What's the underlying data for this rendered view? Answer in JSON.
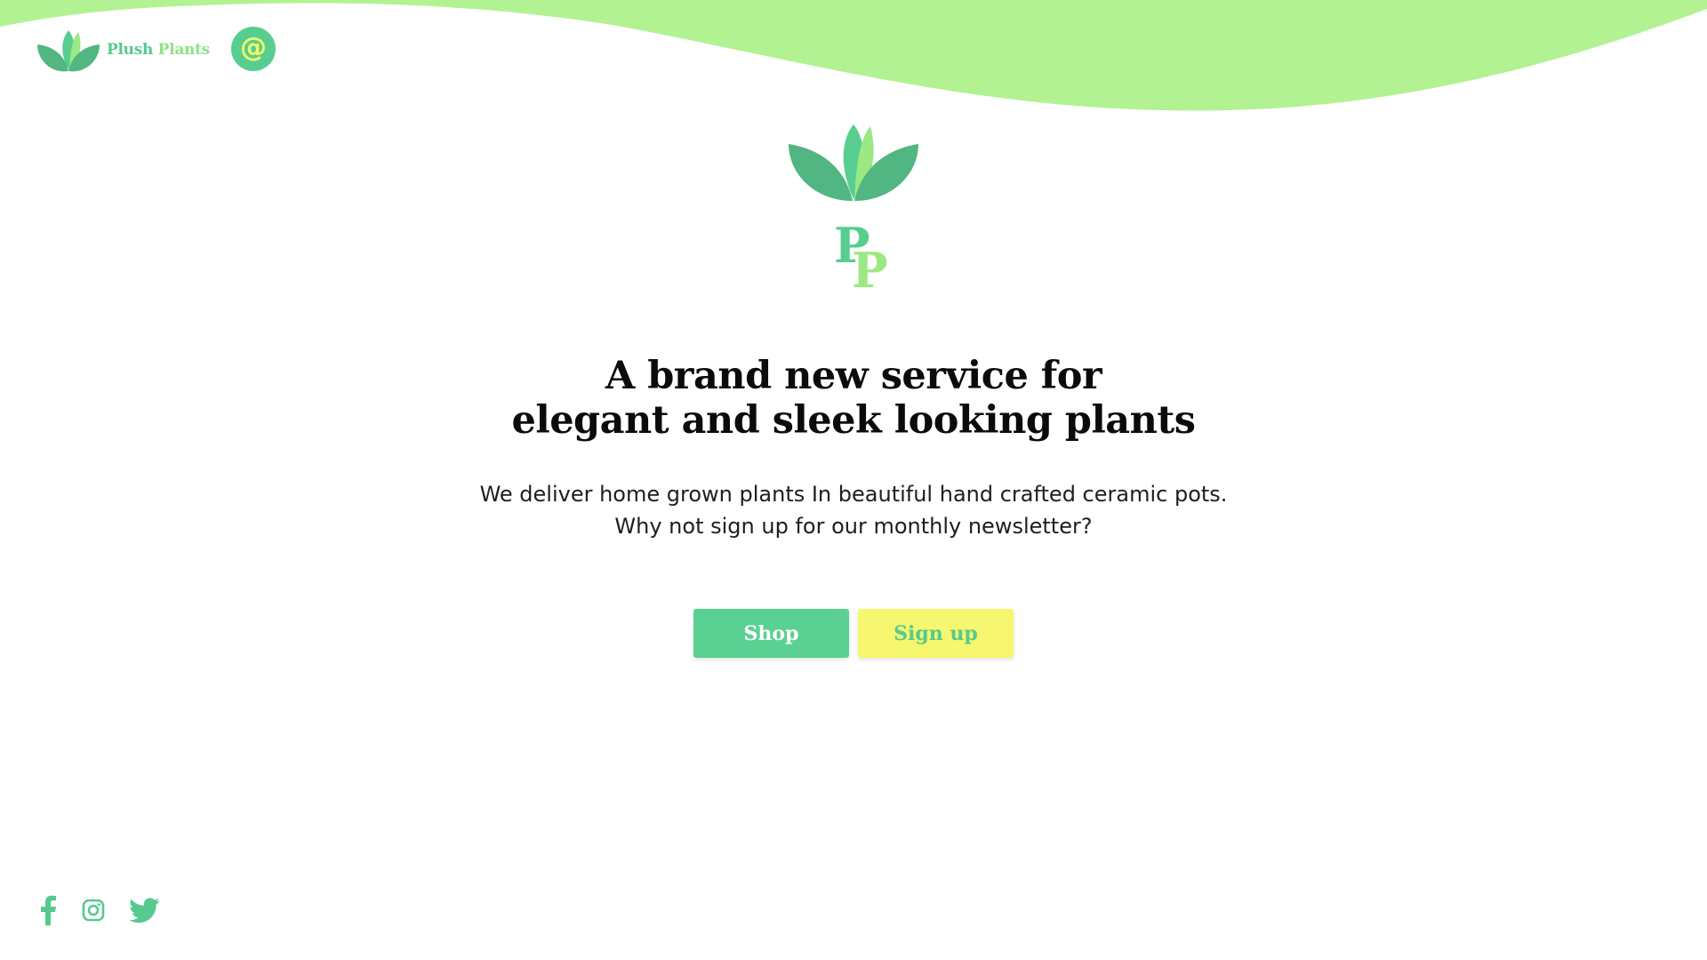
{
  "brand": {
    "word1": "Plush",
    "word2": "Plants",
    "monogram_1": "P",
    "monogram_2": "P"
  },
  "header": {
    "logo_icon": "leaf-logo-icon",
    "contact_icon": "at-sign-icon",
    "contact_glyph": "@"
  },
  "hero": {
    "headline_line1": "A brand new service for",
    "headline_line2": "elegant and sleek looking plants",
    "subtext_line1": "We deliver home grown plants In beautiful hand crafted ceramic pots.",
    "subtext_line2": "Why not sign up for our monthly newsletter?"
  },
  "cta": {
    "shop_label": "Shop",
    "signup_label": "Sign up"
  },
  "social": [
    {
      "name": "facebook",
      "icon": "facebook-icon"
    },
    {
      "name": "instagram",
      "icon": "instagram-icon"
    },
    {
      "name": "twitter",
      "icon": "twitter-icon"
    }
  ],
  "colors": {
    "wave": "#b3f293",
    "leaf_dark": "#51b681",
    "leaf_mid": "#57ce8f",
    "leaf_light": "#9ce883",
    "button_primary": "#5ad192",
    "button_secondary": "#f6f76e",
    "accent_yellow": "#f4f86a"
  }
}
